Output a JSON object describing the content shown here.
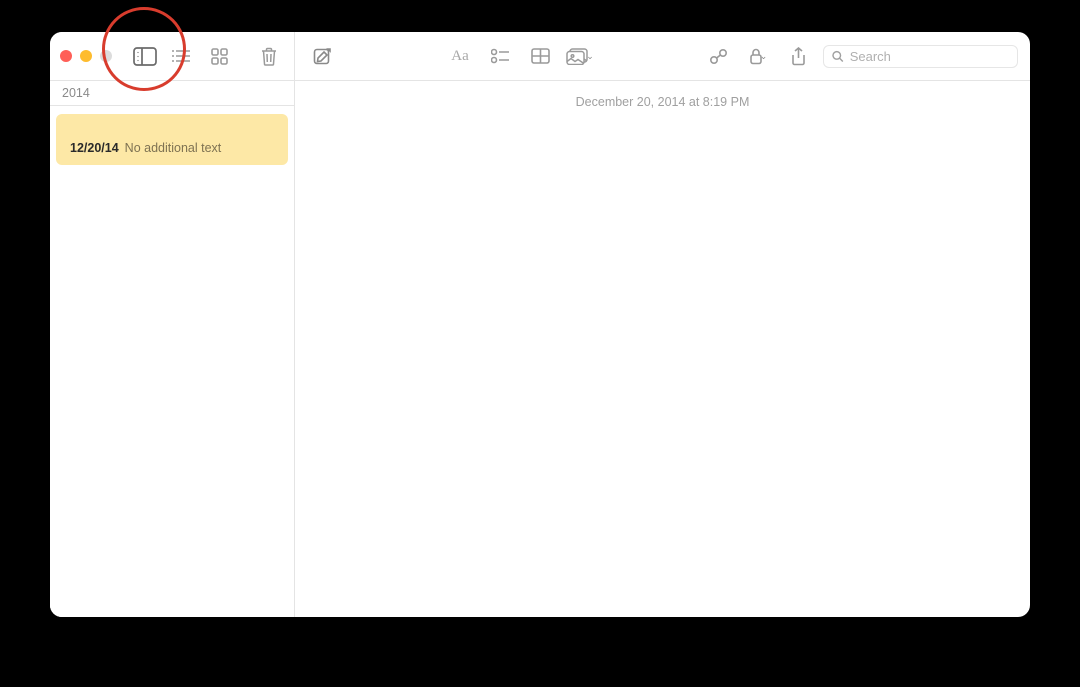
{
  "sidebar": {
    "sectionLabel": "2014",
    "notes": [
      {
        "titleGlyph": "",
        "date": "12/20/14",
        "preview": "No additional text"
      }
    ]
  },
  "toolbar": {
    "searchPlaceholder": "Search"
  },
  "editor": {
    "timestamp": "December 20, 2014 at 8:19 PM",
    "body": ""
  }
}
